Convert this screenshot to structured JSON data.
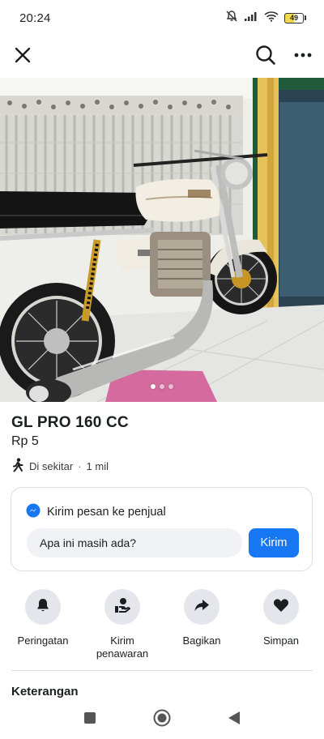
{
  "status": {
    "time": "20:24",
    "battery": "49"
  },
  "nav": {
    "close_icon": "close-icon",
    "search_icon": "search-icon",
    "more_icon": "more-icon"
  },
  "listing": {
    "title": "GL PRO 160 CC",
    "price": "Rp 5",
    "location": "Di sekitar",
    "separator": "·",
    "distance": "1 mil",
    "photo_count": 3,
    "photo_index": 1
  },
  "message": {
    "header": "Kirim pesan ke penjual",
    "input_value": "Apa ini masih ada?",
    "send_label": "Kirim"
  },
  "actions": [
    {
      "label": "Peringatan",
      "icon": "bell-icon"
    },
    {
      "label": "Kirim\npenawaran",
      "icon": "offer-hand-icon"
    },
    {
      "label": "Bagikan",
      "icon": "share-icon"
    },
    {
      "label": "Simpan",
      "icon": "heart-icon"
    }
  ],
  "section": {
    "description_title": "Keterangan"
  },
  "colors": {
    "accent": "#1877f2",
    "action_bg": "#e4e6eb",
    "input_bg": "#f0f2f5"
  }
}
